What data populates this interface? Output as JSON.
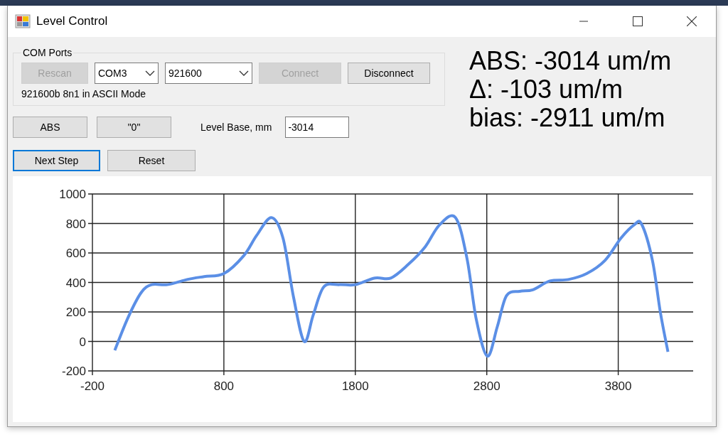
{
  "window": {
    "title": "Level Control"
  },
  "com_ports": {
    "title": "COM Ports",
    "controls": [
      {
        "kind": "button",
        "label": "Rescan",
        "disabled": true
      },
      {
        "kind": "combo",
        "value": "COM3"
      },
      {
        "kind": "combo",
        "value": "921600"
      },
      {
        "kind": "button",
        "label": "Connect",
        "disabled": true
      },
      {
        "kind": "button",
        "label": "Disconnect",
        "disabled": false
      }
    ],
    "status": "921600b 8n1 in ASCII Mode"
  },
  "mode_buttons": [
    {
      "label": "ABS",
      "focused": false
    },
    {
      "label": "\"0\"",
      "focused": false
    }
  ],
  "level_base": {
    "label": "Level Base, mm",
    "value": "-3014"
  },
  "step_buttons": [
    {
      "label": "Next Step",
      "focused": true
    },
    {
      "label": "Reset",
      "focused": false
    }
  ],
  "readings": [
    "ABS: -3014 um/m",
    "Δ: -103 um/m",
    "bias: -2911 um/m"
  ],
  "chart_data": {
    "type": "line",
    "grid": true,
    "xlim": [
      -200,
      4370
    ],
    "ylim": [
      -200,
      1000
    ],
    "xticks": [
      -200,
      800,
      1800,
      2800,
      3800
    ],
    "yticks": [
      -200,
      0,
      200,
      400,
      600,
      800,
      1000
    ],
    "x": [
      -30,
      70,
      170,
      250,
      370,
      520,
      650,
      800,
      950,
      1050,
      1162,
      1250,
      1330,
      1411,
      1480,
      1560,
      1680,
      1800,
      1950,
      2070,
      2200,
      2330,
      2440,
      2562,
      2650,
      2720,
      2805,
      2880,
      2950,
      3050,
      3150,
      3280,
      3420,
      3560,
      3700,
      3820,
      3920,
      3978,
      4060,
      4120,
      4178
    ],
    "series": [
      {
        "color": "#5b8fe6",
        "values": [
          -60,
          160,
          330,
          385,
          385,
          420,
          440,
          460,
          580,
          720,
          840,
          700,
          300,
          0,
          180,
          370,
          385,
          385,
          430,
          430,
          520,
          640,
          790,
          840,
          560,
          150,
          -100,
          100,
          310,
          340,
          350,
          410,
          420,
          460,
          550,
          700,
          790,
          795,
          550,
          200,
          -70
        ]
      }
    ]
  }
}
